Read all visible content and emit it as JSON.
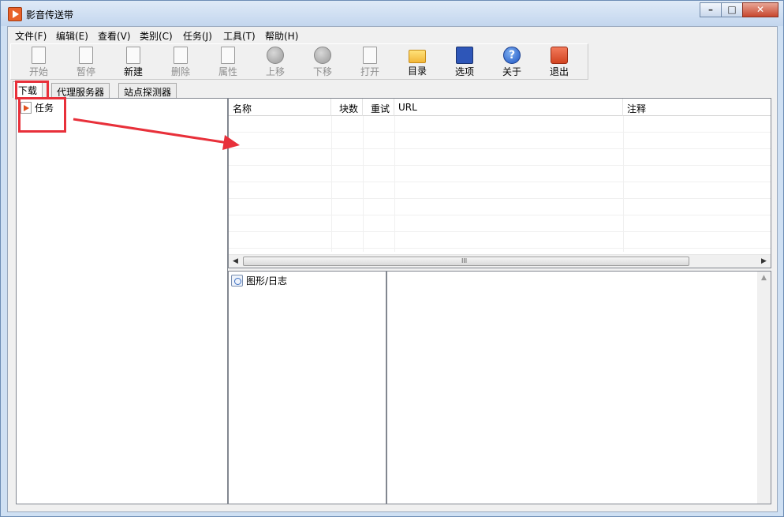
{
  "window": {
    "title": "影音传送带"
  },
  "menu": [
    "文件(F)",
    "编辑(E)",
    "查看(V)",
    "类别(C)",
    "任务(J)",
    "工具(T)",
    "帮助(H)"
  ],
  "toolbar": [
    {
      "label": "开始",
      "icon": "play-icon",
      "enabled": false
    },
    {
      "label": "暂停",
      "icon": "pause-icon",
      "enabled": false
    },
    {
      "label": "新建",
      "icon": "new-task-icon",
      "enabled": true
    },
    {
      "label": "删除",
      "icon": "delete-icon",
      "enabled": false
    },
    {
      "label": "属性",
      "icon": "properties-icon",
      "enabled": false
    },
    {
      "label": "上移",
      "icon": "arrow-up-icon",
      "enabled": false
    },
    {
      "label": "下移",
      "icon": "arrow-down-icon",
      "enabled": false
    },
    {
      "label": "打开",
      "icon": "open-icon",
      "enabled": false
    },
    {
      "label": "目录",
      "icon": "folder-icon",
      "enabled": true
    },
    {
      "label": "选项",
      "icon": "options-icon",
      "enabled": true
    },
    {
      "label": "关于",
      "icon": "help-icon",
      "enabled": true
    },
    {
      "label": "退出",
      "icon": "exit-icon",
      "enabled": true
    }
  ],
  "tabs": [
    "下载",
    "代理服务器",
    "站点探测器"
  ],
  "active_tab": "下载",
  "tree": {
    "root_label": "任务"
  },
  "list": {
    "columns": [
      "名称",
      "块数",
      "重试",
      "URL",
      "注释"
    ]
  },
  "scroll_glyphs": {
    "left": "◀",
    "right": "▶",
    "up": "▲",
    "grip": "III"
  },
  "graph": {
    "label": "图形/日志"
  },
  "window_controls": {
    "minimize": "–",
    "maximize": "□",
    "close": "✕"
  },
  "colors": {
    "annotation": "#e8303a",
    "accent": "#e0521f"
  }
}
